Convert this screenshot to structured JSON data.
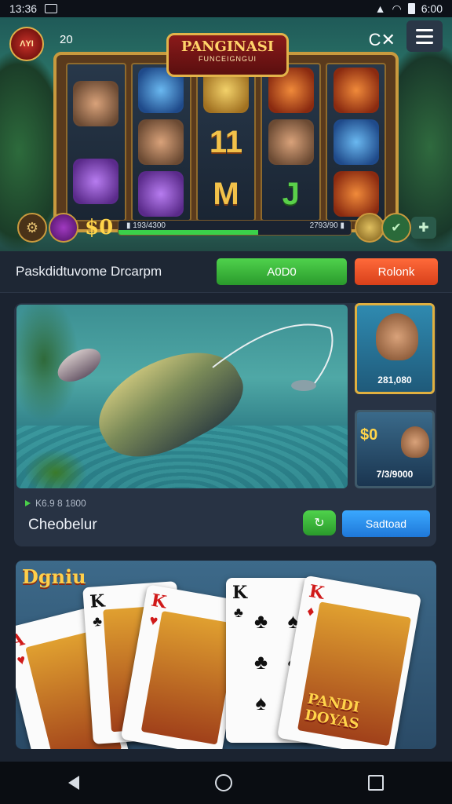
{
  "status_bar": {
    "time": "13:36",
    "clock_right": "6:00"
  },
  "hero": {
    "coin_label": "ΛYI",
    "level": "20",
    "close_label": "C✕",
    "title": "PANGINASI",
    "subtitle": "FUNCEIGNGUI",
    "win_amount": "$0",
    "progress_text_left": "▮ 193/4300",
    "progress_text_right": "2793/90 ▮",
    "progress_fraction": 0.6
  },
  "action_row": {
    "label": "Paskdidtuvome Drcarpm",
    "add_button": "A0D0",
    "roll_button": "Rolonk"
  },
  "fishing_card": {
    "thumb1_value": "281,080",
    "thumb2_big": "$0",
    "thumb2_value": "7/3/9000",
    "meta": "K6.9 8 1800",
    "title": "Cheobelur",
    "share_icon": "↻",
    "select_button": "Sadtoad"
  },
  "card_game": {
    "title": "Dgniu",
    "cards": [
      {
        "rank": "A",
        "suit": "♥",
        "color": "red"
      },
      {
        "rank": "K",
        "suit": "♣",
        "color": "blk"
      },
      {
        "rank": "K",
        "suit": "♥",
        "color": "red"
      },
      {
        "rank": "K",
        "suit": "♣",
        "color": "blk"
      },
      {
        "rank": "K",
        "suit": "♦",
        "color": "red"
      }
    ],
    "card5_caption": "PANDI DOYAS"
  }
}
